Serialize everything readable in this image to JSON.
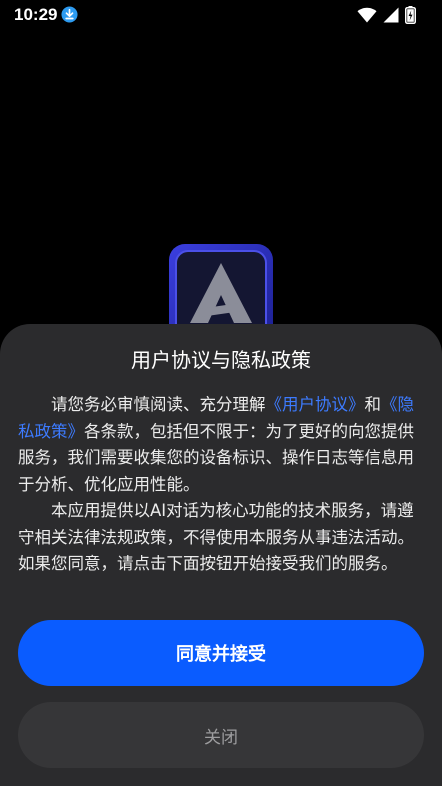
{
  "status_bar": {
    "time": "10:29",
    "icons": [
      "download-icon",
      "wifi-icon",
      "signal-icon",
      "battery-icon"
    ]
  },
  "app_logo": {
    "icon": "app-logo-icon"
  },
  "dialog": {
    "title": "用户协议与隐私政策",
    "p1_a": "请您务必审慎阅读、充分理解",
    "p1_link1": "《用户协议》",
    "p1_b": "和",
    "p1_link2": "《隐私政策》",
    "p1_c": "各条款，包括但不限于：为了更好的向您提供服务，我们需要收集您的设备标识、操作日志等信息用于分析、优化应用性能。",
    "p2": "本应用提供以AI对话为核心功能的技术服务，请遵守相关法律法规政策，不得使用本服务从事违法活动。如果您同意，请点击下面按钮开始接受我们的服务。",
    "agree_label": "同意并接受",
    "close_label": "关闭"
  },
  "colors": {
    "background": "#000000",
    "dialog": "#2b2b2d",
    "link": "#3d7bff",
    "primary_button": "#0a5cff",
    "secondary_button": "#363638"
  }
}
